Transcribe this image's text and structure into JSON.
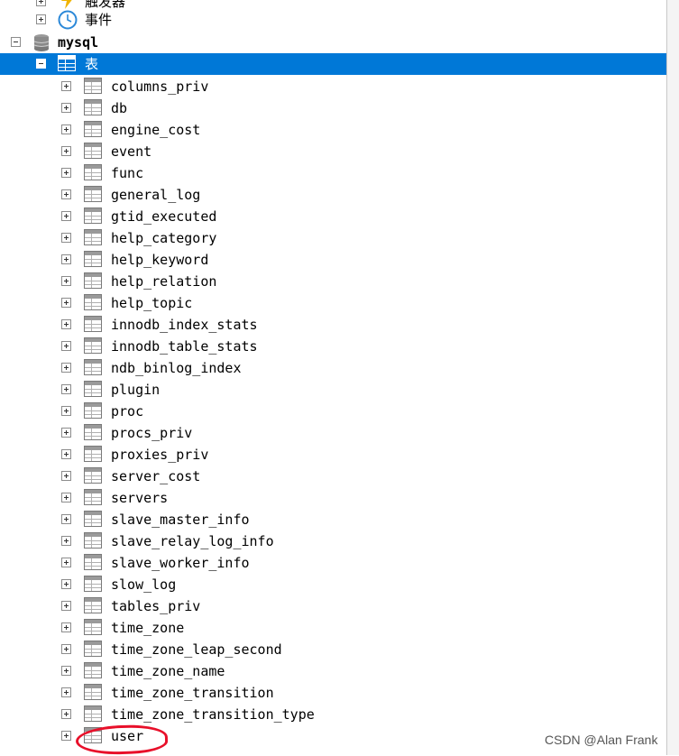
{
  "tree": {
    "triggers_label": "触发器",
    "events_label": "事件",
    "database": {
      "name": "mysql"
    },
    "tables_node": {
      "label": "表"
    },
    "tables": [
      "columns_priv",
      "db",
      "engine_cost",
      "event",
      "func",
      "general_log",
      "gtid_executed",
      "help_category",
      "help_keyword",
      "help_relation",
      "help_topic",
      "innodb_index_stats",
      "innodb_table_stats",
      "ndb_binlog_index",
      "plugin",
      "proc",
      "procs_priv",
      "proxies_priv",
      "server_cost",
      "servers",
      "slave_master_info",
      "slave_relay_log_info",
      "slave_worker_info",
      "slow_log",
      "tables_priv",
      "time_zone",
      "time_zone_leap_second",
      "time_zone_name",
      "time_zone_transition",
      "time_zone_transition_type",
      "user"
    ]
  },
  "watermark": "CSDN @Alan Frank",
  "colors": {
    "selection": "#0078d7",
    "annotation": "#e8102a"
  }
}
